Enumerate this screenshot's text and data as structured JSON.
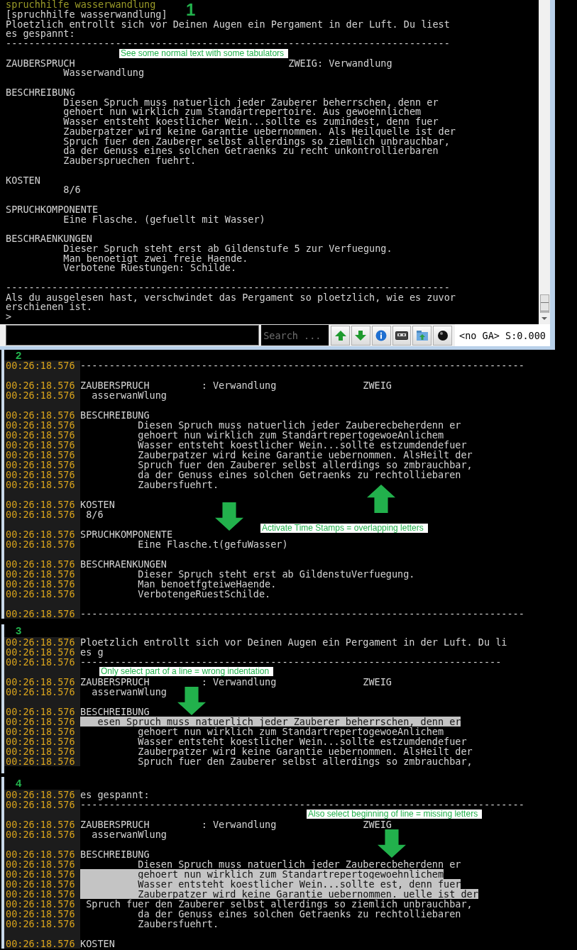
{
  "panels": [
    {
      "number": "1",
      "kind": "client",
      "annotation": "See some normal text with some tabulators",
      "lines": [
        {
          "kind": "echo",
          "text": "spruchhilfe wasserwandlung"
        },
        {
          "kind": "text",
          "text": "[spruchhilfe wasserwandlung]",
          "selected": false
        },
        {
          "kind": "text",
          "text": "Ploetzlich entrollt sich vor Deinen Augen ein Pergament in der Luft. Du liest",
          "selected": false
        },
        {
          "kind": "text",
          "text": "es gespannt:",
          "selected": false
        },
        {
          "kind": "text",
          "text": "-----------------------------------------------------------------------------",
          "selected": false
        },
        {
          "kind": "blank"
        },
        {
          "kind": "text",
          "text": "ZAUBERSPRUCH                                     ZWEIG: Verwandlung",
          "selected": false
        },
        {
          "kind": "text",
          "text": "          Wasserwandlung",
          "selected": false
        },
        {
          "kind": "blank"
        },
        {
          "kind": "text",
          "text": "BESCHREIBUNG",
          "selected": false
        },
        {
          "kind": "text",
          "text": "          Diesen Spruch muss natuerlich jeder Zauberer beherrschen, denn er",
          "selected": false
        },
        {
          "kind": "text",
          "text": "          gehoert nun wirklich zum Standartrepertoire. Aus gewoehnlichem",
          "selected": false
        },
        {
          "kind": "text",
          "text": "          Wasser entsteht koestlicher Wein...sollte es zumindest, denn fuer",
          "selected": false
        },
        {
          "kind": "text",
          "text": "          Zauberpatzer wird keine Garantie uebernommen. Als Heilquelle ist der",
          "selected": false
        },
        {
          "kind": "text",
          "text": "          Spruch fuer den Zauberer selbst allerdings so ziemlich unbrauchbar,",
          "selected": false
        },
        {
          "kind": "text",
          "text": "          da der Genuss eines solchen Getraenks zu recht unkontrollierbaren",
          "selected": false
        },
        {
          "kind": "text",
          "text": "          Zauberspruechen fuehrt.",
          "selected": false
        },
        {
          "kind": "blank"
        },
        {
          "kind": "text",
          "text": "KOSTEN",
          "selected": false
        },
        {
          "kind": "text",
          "text": "          8/6",
          "selected": false
        },
        {
          "kind": "blank"
        },
        {
          "kind": "text",
          "text": "SPRUCHKOMPONENTE",
          "selected": false
        },
        {
          "kind": "text",
          "text": "          Eine Flasche. (gefuellt mit Wasser)",
          "selected": false
        },
        {
          "kind": "blank"
        },
        {
          "kind": "text",
          "text": "BESCHRAENKUNGEN",
          "selected": false
        },
        {
          "kind": "text",
          "text": "          Dieser Spruch steht erst ab Gildenstufe 5 zur Verfuegung.",
          "selected": false
        },
        {
          "kind": "text",
          "text": "          Man benoetigt zwei freie Haende.",
          "selected": false
        },
        {
          "kind": "text",
          "text": "          Verbotene Ruestungen: Schilde.",
          "selected": false
        },
        {
          "kind": "blank"
        },
        {
          "kind": "text",
          "text": "-----------------------------------------------------------------------------",
          "selected": false
        },
        {
          "kind": "text",
          "text": "Als du ausgelesen hast, verschwindet das Pergament so ploetzlich, wie es zuvor",
          "selected": false
        },
        {
          "kind": "text",
          "text": "erschienen ist.",
          "selected": false
        },
        {
          "kind": "prompt",
          "text": ">"
        }
      ],
      "search": {
        "placeholder": "Search ..."
      },
      "status": "<no GA> S:0.000"
    },
    {
      "number": "2",
      "kind": "timestamped",
      "annotation": "Activate Time Stamps = overlapping letters",
      "arrows": [
        {
          "kind": "up"
        },
        {
          "kind": "down"
        }
      ],
      "lines": [
        {
          "kind": "text",
          "time": "00:26:18.576",
          "text": "-----------------------------------------------------------------------------",
          "selected": false
        },
        {
          "kind": "blank"
        },
        {
          "kind": "text",
          "time": "00:26:18.576",
          "text": "ZAUBERSPRUCH         : Verwandlung               ZWEIG",
          "selected": false
        },
        {
          "kind": "text",
          "time": "00:26:18.576",
          "text": "  asserwanWlung",
          "selected": false
        },
        {
          "kind": "blank"
        },
        {
          "kind": "text",
          "time": "00:26:18.576",
          "text": "BESCHREIBUNG",
          "selected": false
        },
        {
          "kind": "text",
          "time": "00:26:18.576",
          "text": "          Diesen Spruch muss natuerlich jeder Zauberecbeherdenn er",
          "selected": false
        },
        {
          "kind": "text",
          "time": "00:26:18.576",
          "text": "          gehoert nun wirklich zum StandartrepertogewoeAnlichem",
          "selected": false
        },
        {
          "kind": "text",
          "time": "00:26:18.576",
          "text": "          Wasser entsteht koestlicher Wein...sollte estzumdendefuer",
          "selected": false
        },
        {
          "kind": "text",
          "time": "00:26:18.576",
          "text": "          Zauberpatzer wird keine Garantie uebernommen. AlsHeilt der",
          "selected": false
        },
        {
          "kind": "text",
          "time": "00:26:18.576",
          "text": "          Spruch fuer den Zauberer selbst allerdings so zmbrauchbar,",
          "selected": false
        },
        {
          "kind": "text",
          "time": "00:26:18.576",
          "text": "          da der Genuss eines solchen Getraenks zu rechtolliebaren",
          "selected": false
        },
        {
          "kind": "text",
          "time": "00:26:18.576",
          "text": "          Zaubersfuehrt.",
          "selected": false
        },
        {
          "kind": "blank"
        },
        {
          "kind": "text",
          "time": "00:26:18.576",
          "text": "KOSTEN",
          "selected": false
        },
        {
          "kind": "text",
          "time": "00:26:18.576",
          "text": " 8/6",
          "selected": false
        },
        {
          "kind": "blank"
        },
        {
          "kind": "text",
          "time": "00:26:18.576",
          "text": "SPRUCHKOMPONENTE",
          "selected": false
        },
        {
          "kind": "text",
          "time": "00:26:18.576",
          "text": "          Eine Flasche.t(gefuWasser)",
          "selected": false
        },
        {
          "kind": "blank"
        },
        {
          "kind": "text",
          "time": "00:26:18.576",
          "text": "BESCHRAENKUNGEN",
          "selected": false
        },
        {
          "kind": "text",
          "time": "00:26:18.576",
          "text": "          Dieser Spruch steht erst ab GildenstuVerfuegung.",
          "selected": false
        },
        {
          "kind": "text",
          "time": "00:26:18.576",
          "text": "          Man benoetfgteiweHaende.",
          "selected": false
        },
        {
          "kind": "text",
          "time": "00:26:18.576",
          "text": "          VerbotengeRuestSchilde.",
          "selected": false
        },
        {
          "kind": "blank"
        },
        {
          "kind": "text",
          "time": "00:26:18.576",
          "text": "-----------------------------------------------------------------------------",
          "selected": false
        }
      ]
    },
    {
      "number": "3",
      "kind": "timestamped",
      "annotation": "Only select part of a line = wrong indentation",
      "arrows": [
        {
          "kind": "down"
        }
      ],
      "lines": [
        {
          "kind": "text",
          "time": "00:26:18.576",
          "text": "Ploetzlich entrollt sich vor Deinen Augen ein Pergament in der Luft. Du li",
          "selected": false
        },
        {
          "kind": "text",
          "time": "00:26:18.576",
          "text": "es g",
          "selected": false
        },
        {
          "kind": "text",
          "time": "00:26:18.576",
          "text": "-------------------------------------------------------------------------",
          "selected": false
        },
        {
          "kind": "blank"
        },
        {
          "kind": "text",
          "time": "00:26:18.576",
          "text": "ZAUBERSPRUCH         : Verwandlung               ZWEIG",
          "selected": false
        },
        {
          "kind": "text",
          "time": "00:26:18.576",
          "text": "  asserwanWlung",
          "selected": false
        },
        {
          "kind": "blank"
        },
        {
          "kind": "text",
          "time": "00:26:18.576",
          "text": "BESCHREIBUNG",
          "selected": false
        },
        {
          "kind": "text",
          "time": "00:26:18.576",
          "text": "   esen Spruch muss natuerlich jeder Zauberer beherrschen, denn er",
          "selected": true
        },
        {
          "kind": "text",
          "time": "00:26:18.576",
          "text": "          gehoert nun wirklich zum StandartrepertogewoeAnlichem",
          "selected": false
        },
        {
          "kind": "text",
          "time": "00:26:18.576",
          "text": "          Wasser entsteht koestlicher Wein...sollte estzumdendefuer",
          "selected": false
        },
        {
          "kind": "text",
          "time": "00:26:18.576",
          "text": "          Zauberpatzer wird keine Garantie uebernommen. AlsHeilt der",
          "selected": false
        },
        {
          "kind": "text",
          "time": "00:26:18.576",
          "text": "          Spruch fuer den Zauberer selbst allerdings so zmbrauchbar,",
          "selected": false
        }
      ]
    },
    {
      "number": "4",
      "kind": "timestamped",
      "annotation": "Also select beginning of line = missing letters",
      "arrows": [
        {
          "kind": "down"
        }
      ],
      "lines": [
        {
          "kind": "text",
          "time": "00:26:18.576",
          "text": "es gespannt:",
          "selected": false
        },
        {
          "kind": "text",
          "time": "00:26:18.576",
          "text": "-----------------------------------------------------------------------------",
          "selected": false
        },
        {
          "kind": "blank"
        },
        {
          "kind": "text",
          "time": "00:26:18.576",
          "text": "ZAUBERSPRUCH         : Verwandlung               ZWEIG",
          "selected": false
        },
        {
          "kind": "text",
          "time": "00:26:18.576",
          "text": "  asserwanWlung",
          "selected": false
        },
        {
          "kind": "blank"
        },
        {
          "kind": "text",
          "time": "00:26:18.576",
          "text": "BESCHREIBUNG",
          "selected": false
        },
        {
          "kind": "text",
          "time": "00:26:18.576",
          "text": "          Diesen Spruch muss natuerlich jeder Zauberecbeherdenn er",
          "selected": false
        },
        {
          "kind": "text",
          "time": "00:26:18.576",
          "text": "          gehoert nun wirklich zum Standartrepertogewoehnlichem",
          "selected": true
        },
        {
          "kind": "text",
          "time": "00:26:18.576",
          "text": "          Wasser entsteht koestlicher Wein...sollte est, denn fuer",
          "selected": true
        },
        {
          "kind": "text",
          "time": "00:26:18.576",
          "text": "          Zauberpatzer wird keine Garantie uebernommen. uelle ist der",
          "selected": true
        },
        {
          "kind": "text",
          "time": "00:26:18.576",
          "text": " Spruch fuer den Zauberer selbst allerdings so ziemlich unbrauchbar,",
          "selected": false
        },
        {
          "kind": "text",
          "time": "00:26:18.576",
          "text": "          da der Genuss eines solchen Getraenks zu rechtolliebaren",
          "selected": false
        },
        {
          "kind": "text",
          "time": "00:26:18.576",
          "text": "          Zaubersfuehrt.",
          "selected": false
        },
        {
          "kind": "blank"
        },
        {
          "kind": "text",
          "time": "00:26:18.576",
          "text": "KOSTEN",
          "selected": false
        }
      ]
    }
  ]
}
